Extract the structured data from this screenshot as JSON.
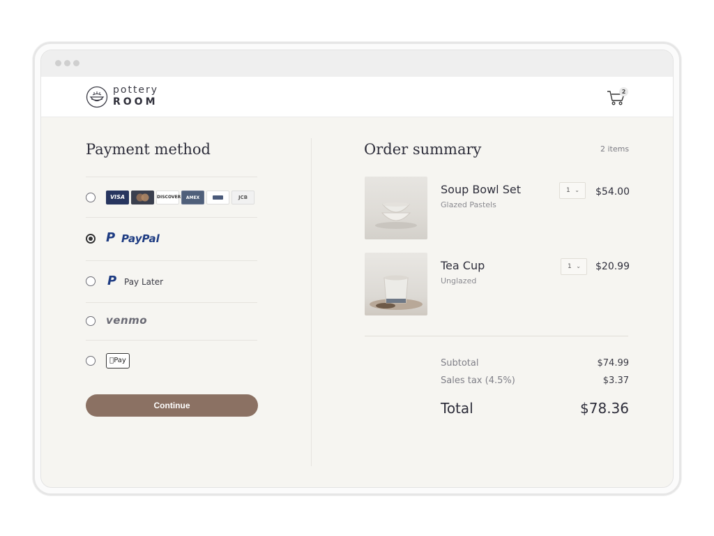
{
  "brand": {
    "line1": "pottery",
    "line2": "ROOM"
  },
  "header": {
    "cart_count": "2"
  },
  "payment": {
    "title": "Payment method",
    "cards": [
      "VISA",
      "Mastercard",
      "DISCOVER",
      "AMEX",
      "Diners",
      "JCB"
    ],
    "paypal_label": "PayPal",
    "paylater_label": "Pay Later",
    "venmo_label": "venmo",
    "applepay_label": "Pay",
    "selected": "paypal",
    "continue_label": "Continue"
  },
  "summary": {
    "title": "Order summary",
    "items_count": "2 items",
    "items": [
      {
        "name": "Soup Bowl Set",
        "variant": "Glazed Pastels",
        "qty": "1",
        "price": "$54.00"
      },
      {
        "name": "Tea Cup",
        "variant": "Unglazed",
        "qty": "1",
        "price": "$20.99"
      }
    ],
    "subtotal_label": "Subtotal",
    "subtotal": "$74.99",
    "tax_label": "Sales tax (4.5%)",
    "tax": "$3.37",
    "total_label": "Total",
    "total": "$78.36"
  },
  "colors": {
    "accent": "#8b7163",
    "background": "#f6f5f1",
    "text": "#2d2d3a"
  }
}
